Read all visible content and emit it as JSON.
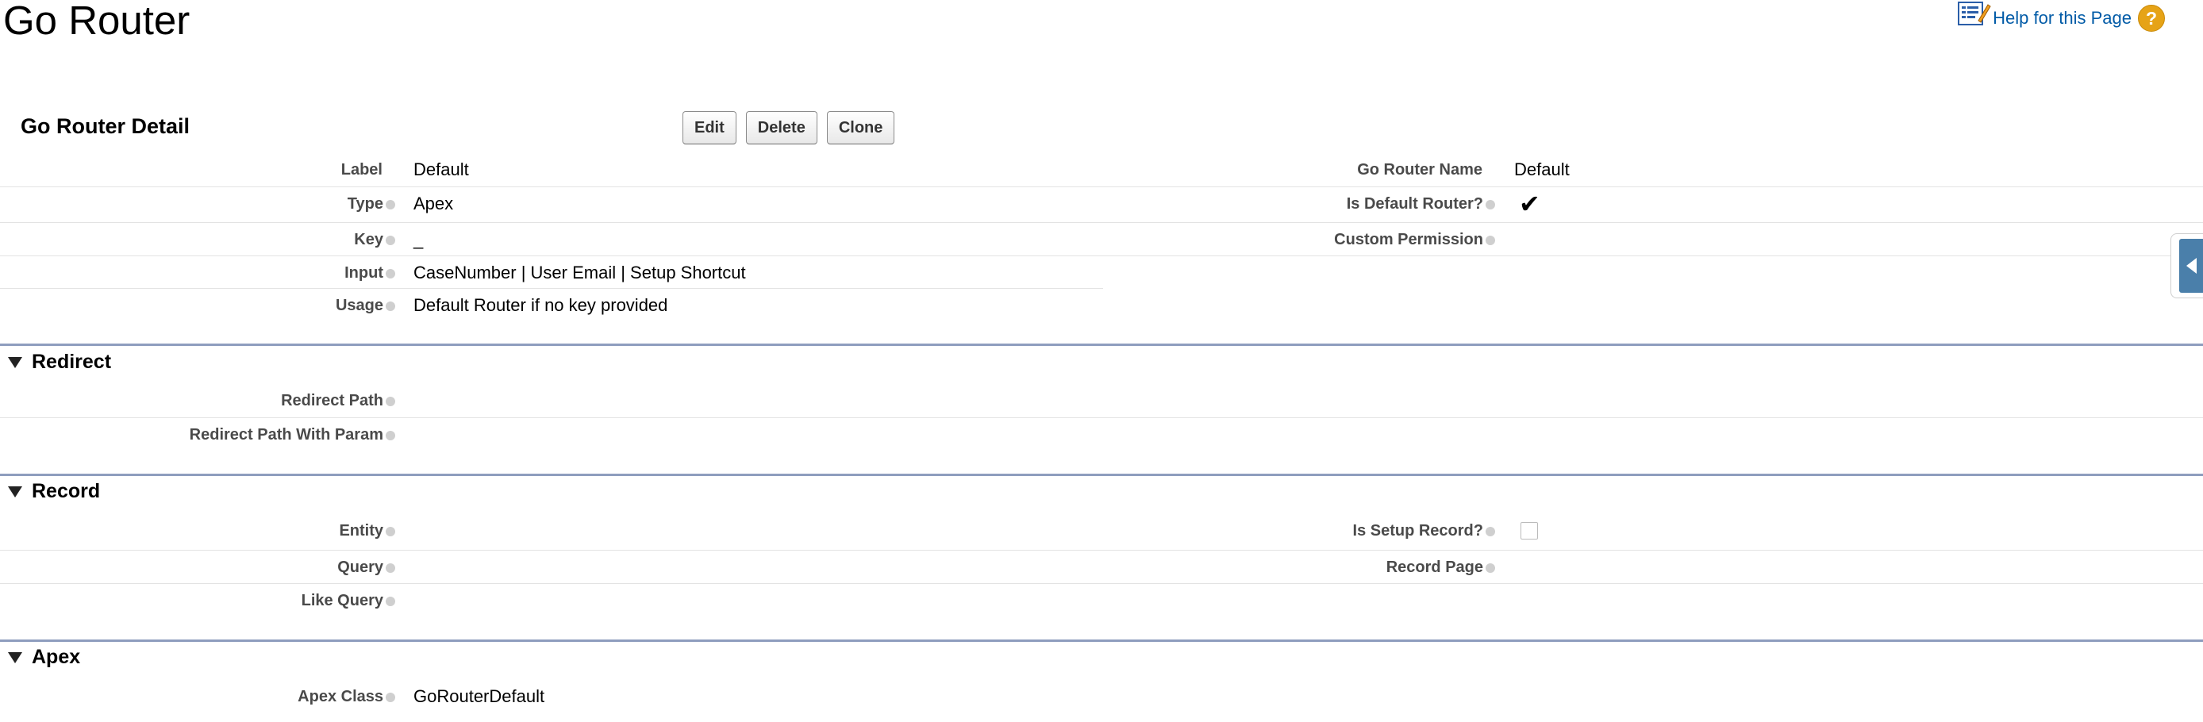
{
  "page": {
    "title": "Go Router"
  },
  "help": {
    "label": "Help for this Page",
    "icon": "help-doc-icon",
    "badge": "?"
  },
  "detail": {
    "title": "Go Router Detail",
    "buttons": {
      "edit": "Edit",
      "delete": "Delete",
      "clone": "Clone"
    }
  },
  "fields": {
    "label": {
      "label": "Label",
      "value": "Default"
    },
    "type": {
      "label": "Type",
      "value": "Apex"
    },
    "key": {
      "label": "Key",
      "value": "_"
    },
    "input": {
      "label": "Input",
      "value": "CaseNumber | User Email | Setup Shortcut"
    },
    "usage": {
      "label": "Usage",
      "value": "Default Router if no key provided"
    },
    "go_router_name": {
      "label": "Go Router Name",
      "value": "Default"
    },
    "is_default_router": {
      "label": "Is Default Router?",
      "checked": true
    },
    "custom_permission": {
      "label": "Custom Permission",
      "value": ""
    }
  },
  "sections": {
    "redirect": {
      "title": "Redirect",
      "redirect_path": {
        "label": "Redirect Path",
        "value": ""
      },
      "redirect_path_with_param": {
        "label": "Redirect Path With Param",
        "value": ""
      }
    },
    "record": {
      "title": "Record",
      "entity": {
        "label": "Entity",
        "value": ""
      },
      "query": {
        "label": "Query",
        "value": ""
      },
      "like_query": {
        "label": "Like Query",
        "value": ""
      },
      "is_setup_record": {
        "label": "Is Setup Record?",
        "checked": false
      },
      "record_page": {
        "label": "Record Page",
        "value": ""
      }
    },
    "apex": {
      "title": "Apex",
      "apex_class": {
        "label": "Apex Class",
        "value": "GoRouterDefault"
      }
    }
  },
  "colors": {
    "link": "#015ba7",
    "section_rule": "#8e9dbe",
    "side_tab": "#4a7faa",
    "help_badge": "#e6a317"
  }
}
